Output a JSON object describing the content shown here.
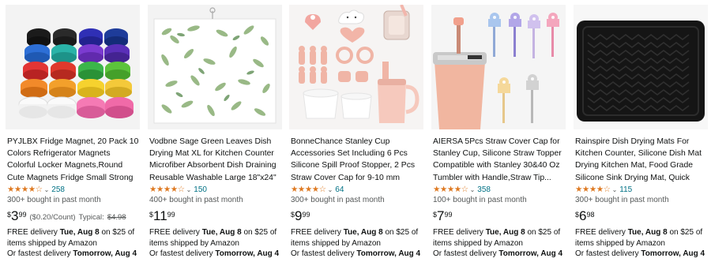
{
  "products": [
    {
      "title": "PYJLBX Fridge Magnet, 20 Pack 10 Colors Refrigerator Magnets Colorful Locker Magnets,Round Cute Magnets Fridge Small Strong Magnets for...",
      "stars": "★★★★☆",
      "rating_value": 4.5,
      "chevron": "⌄",
      "review_count": "258",
      "bought": "300+ bought in past month",
      "price_symbol": "$",
      "price_whole": "3",
      "price_fraction": "99",
      "unit_price": "($0.20/Count)",
      "typical_label": "Typical:",
      "typical_price": "$4.98",
      "delivery_line1_prefix": "FREE delivery ",
      "delivery_date": "Tue, Aug 8",
      "delivery_line1_suffix": " on $25 of items shipped by Amazon",
      "fastest_prefix": "Or fastest delivery ",
      "fastest_date": "Tomorrow, Aug 4",
      "image_icon": "magnets-image"
    },
    {
      "title": "Vodbne Sage Green Leaves Dish Drying Mat XL for Kitchen Counter Microfiber Absorbent Dish Draining Reusable Washable Large 18\"x24\"",
      "stars": "★★★★☆",
      "rating_value": 4.5,
      "chevron": "⌄",
      "review_count": "150",
      "bought": "400+ bought in past month",
      "price_symbol": "$",
      "price_whole": "11",
      "price_fraction": "99",
      "unit_price": "",
      "typical_label": "",
      "typical_price": "",
      "delivery_line1_prefix": "FREE delivery ",
      "delivery_date": "Tue, Aug 8",
      "delivery_line1_suffix": " on $25 of items shipped by Amazon",
      "fastest_prefix": "Or fastest delivery ",
      "fastest_date": "Tomorrow, Aug 4",
      "image_icon": "leaf-mat-image"
    },
    {
      "title": "BonneChance Stanley Cup Accessories Set Including 6 Pcs Silicone Spill Proof Stopper, 2 Pcs Straw Cover Cap for 9-10 mm Stra...",
      "stars": "★★★★☆",
      "rating_value": 4.5,
      "chevron": "⌄",
      "review_count": "64",
      "bought": "300+ bought in past month",
      "price_symbol": "$",
      "price_whole": "9",
      "price_fraction": "99",
      "unit_price": "",
      "typical_label": "",
      "typical_price": "",
      "delivery_line1_prefix": "FREE delivery ",
      "delivery_date": "Tue, Aug 8",
      "delivery_line1_suffix": " on $25 of items shipped by Amazon",
      "fastest_prefix": "Or fastest delivery ",
      "fastest_date": "Tomorrow, Aug 4",
      "image_icon": "cup-accessories-image"
    },
    {
      "title": "AIERSA 5Pcs Straw Cover Cap for Stanley Cup, Silicone Straw Topper Compatible with Stanley 30&40 Oz Tumbler with Handle,Straw Tip...",
      "stars": "★★★★☆",
      "rating_value": 4.5,
      "chevron": "⌄",
      "review_count": "358",
      "bought": "100+ bought in past month",
      "price_symbol": "$",
      "price_whole": "7",
      "price_fraction": "99",
      "unit_price": "",
      "typical_label": "",
      "typical_price": "",
      "delivery_line1_prefix": "FREE delivery ",
      "delivery_date": "Tue, Aug 8",
      "delivery_line1_suffix": " on $25 of items shipped by Amazon",
      "fastest_prefix": "Or fastest delivery ",
      "fastest_date": "Tomorrow, Aug 4",
      "image_icon": "straw-covers-image"
    },
    {
      "title": "Rainspire Dish Drying Mats For Kitchen Counter, Silicone Dish Mat Drying Kitchen Mat, Food Grade Silicone Sink Drying Mat, Quick Dry...",
      "stars": "★★★★☆",
      "rating_value": 4.5,
      "chevron": "⌄",
      "review_count": "115",
      "bought": "300+ bought in past month",
      "price_symbol": "$",
      "price_whole": "6",
      "price_fraction": "98",
      "unit_price": "",
      "typical_label": "",
      "typical_price": "",
      "delivery_line1_prefix": "FREE delivery ",
      "delivery_date": "Tue, Aug 8",
      "delivery_line1_suffix": " on $25 of items shipped by Amazon",
      "fastest_prefix": "Or fastest delivery ",
      "fastest_date": "Tomorrow, Aug 4",
      "image_icon": "silicone-mat-image"
    }
  ],
  "colors": {
    "star": "#de7921",
    "link": "#007185",
    "text": "#0f1111",
    "muted": "#565959",
    "image_bg": "#f3f3f3"
  }
}
